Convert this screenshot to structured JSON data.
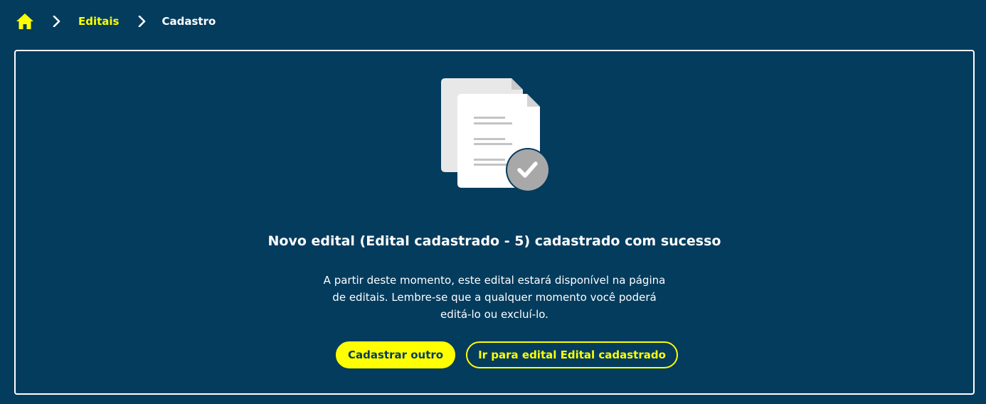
{
  "breadcrumb": {
    "home_icon": "home-icon",
    "separator_icon": "chevron-right-icon",
    "link_label": "Editais",
    "current_label": "Cadastro"
  },
  "card": {
    "illustration_icon": "documents-check-icon",
    "title": "Novo edital (Edital cadastrado - 5) cadastrado com sucesso",
    "description": "A partir deste momento, este edital estará disponível na página de editais. Lembre-se que a qualquer momento você poderá editá-lo ou excluí-lo.",
    "primary_button": "Cadastrar outro",
    "secondary_button": "Ir para edital Edital cadastrado"
  },
  "colors": {
    "background": "#043c5e",
    "accent": "#ffff00",
    "text": "#ffffff"
  }
}
